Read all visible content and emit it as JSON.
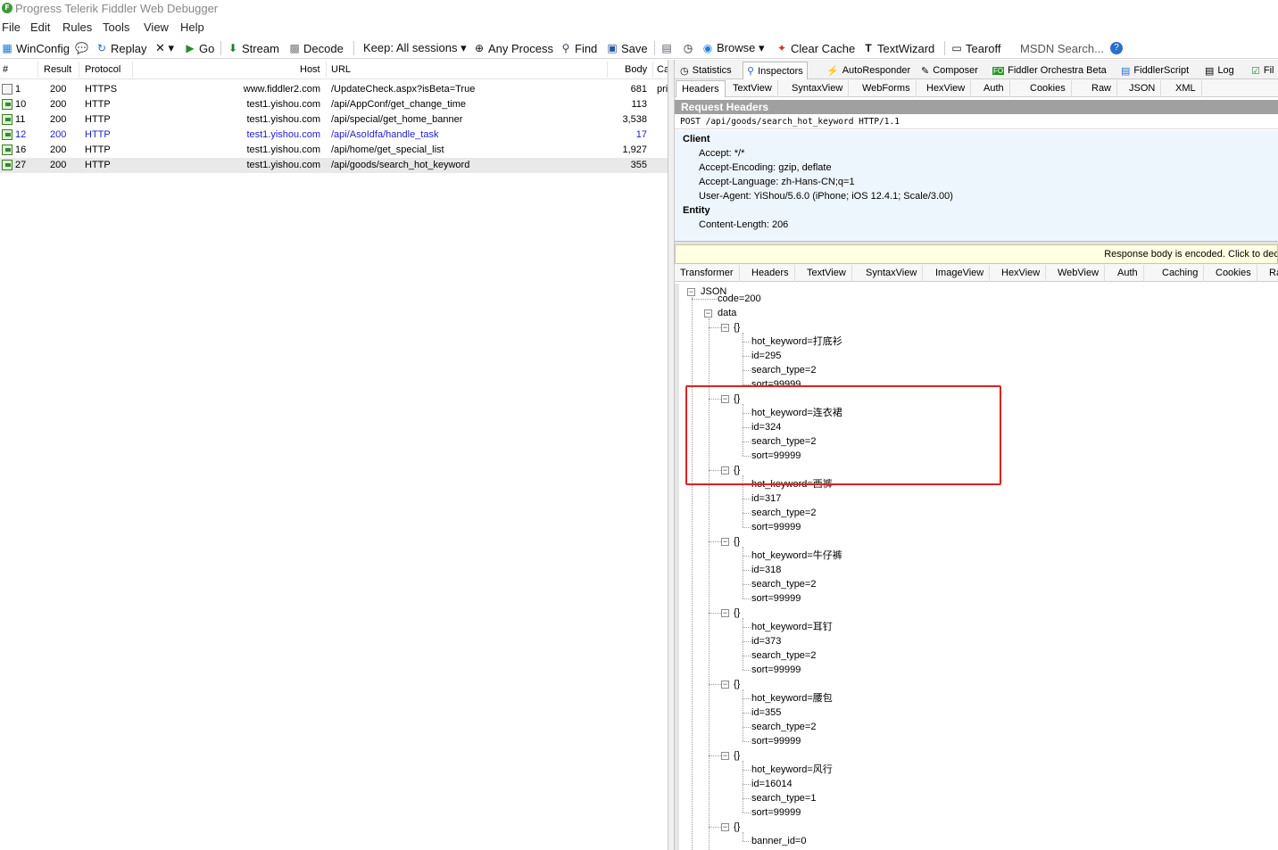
{
  "window": {
    "title": "Progress Telerik Fiddler Web Debugger",
    "logo": "F"
  },
  "menu": [
    "File",
    "Edit",
    "Rules",
    "Tools",
    "View",
    "Help"
  ],
  "toolbar": {
    "winconfig": "WinConfig",
    "replay": "Replay",
    "remove": "✕ ▾",
    "go": "Go",
    "stream": "Stream",
    "decode": "Decode",
    "keep": "Keep: All sessions ▾",
    "any_process": "Any Process",
    "find": "Find",
    "save": "Save",
    "browse": "Browse ▾",
    "clear_cache": "Clear Cache",
    "textwizard": "TextWizard",
    "tearoff": "Tearoff",
    "msdn_search": "MSDN Search..."
  },
  "sessions": {
    "columns": {
      "num": "#",
      "result": "Result",
      "protocol": "Protocol",
      "host": "Host",
      "url": "URL",
      "body": "Body",
      "caching": "Ca"
    },
    "rows": [
      {
        "id": "1",
        "result": "200",
        "protocol": "HTTPS",
        "host": "www.fiddler2.com",
        "url": "/UpdateCheck.aspx?isBeta=True",
        "body": "681",
        "caching": "pri",
        "type": "doc"
      },
      {
        "id": "10",
        "result": "200",
        "protocol": "HTTP",
        "host": "test1.yishou.com",
        "url": "/api/AppConf/get_change_time",
        "body": "113",
        "caching": "",
        "type": "req"
      },
      {
        "id": "11",
        "result": "200",
        "protocol": "HTTP",
        "host": "test1.yishou.com",
        "url": "/api/special/get_home_banner",
        "body": "3,538",
        "caching": "",
        "type": "req"
      },
      {
        "id": "12",
        "result": "200",
        "protocol": "HTTP",
        "host": "test1.yishou.com",
        "url": "/api/AsoIdfa/handle_task",
        "body": "17",
        "caching": "",
        "type": "req"
      },
      {
        "id": "16",
        "result": "200",
        "protocol": "HTTP",
        "host": "test1.yishou.com",
        "url": "/api/home/get_special_list",
        "body": "1,927",
        "caching": "",
        "type": "req"
      },
      {
        "id": "27",
        "result": "200",
        "protocol": "HTTP",
        "host": "test1.yishou.com",
        "url": "/api/goods/search_hot_keyword",
        "body": "355",
        "caching": "",
        "type": "req"
      }
    ]
  },
  "main_tabs": [
    "Statistics",
    "Inspectors",
    "AutoResponder",
    "Composer",
    "Fiddler Orchestra Beta",
    "FiddlerScript",
    "Log",
    "Fil"
  ],
  "request_tabs": [
    "Headers",
    "TextView",
    "SyntaxView",
    "WebForms",
    "HexView",
    "Auth",
    "Cookies",
    "Raw",
    "JSON",
    "XML"
  ],
  "request": {
    "section_title": "Request Headers",
    "request_line": "POST /api/goods/search_hot_keyword HTTP/1.1",
    "groups": [
      {
        "name": "Client",
        "headers": [
          "Accept: */*",
          "Accept-Encoding: gzip, deflate",
          "Accept-Language: zh-Hans-CN;q=1",
          "User-Agent: YiShou/5.6.0 (iPhone; iOS 12.4.1; Scale/3.00)"
        ]
      },
      {
        "name": "Entity",
        "headers": [
          "Content-Length: 206"
        ]
      }
    ]
  },
  "response_notice": "Response body is encoded. Click to deco",
  "response_tabs": [
    "Transformer",
    "Headers",
    "TextView",
    "SyntaxView",
    "ImageView",
    "HexView",
    "WebView",
    "Auth",
    "Caching",
    "Cookies",
    "Ra"
  ],
  "json_tree": {
    "root": "JSON",
    "code": "code=200",
    "data": "data",
    "object_label": "{}",
    "items": [
      [
        "hot_keyword=打底衫",
        "id=295",
        "search_type=2",
        "sort=99999"
      ],
      [
        "hot_keyword=连衣裙",
        "id=324",
        "search_type=2",
        "sort=99999"
      ],
      [
        "hot_keyword=西裤",
        "id=317",
        "search_type=2",
        "sort=99999"
      ],
      [
        "hot_keyword=牛仔裤",
        "id=318",
        "search_type=2",
        "sort=99999"
      ],
      [
        "hot_keyword=耳钉",
        "id=373",
        "search_type=2",
        "sort=99999"
      ],
      [
        "hot_keyword=腰包",
        "id=355",
        "search_type=2",
        "sort=99999"
      ],
      [
        "hot_keyword=风行",
        "id=16014",
        "search_type=1",
        "sort=99999"
      ],
      [
        "banner_id=0"
      ]
    ]
  },
  "colors": {
    "highlight": "#e02020",
    "selected_session": "#1e1ec8",
    "headers_bg": "#eef6fd"
  }
}
